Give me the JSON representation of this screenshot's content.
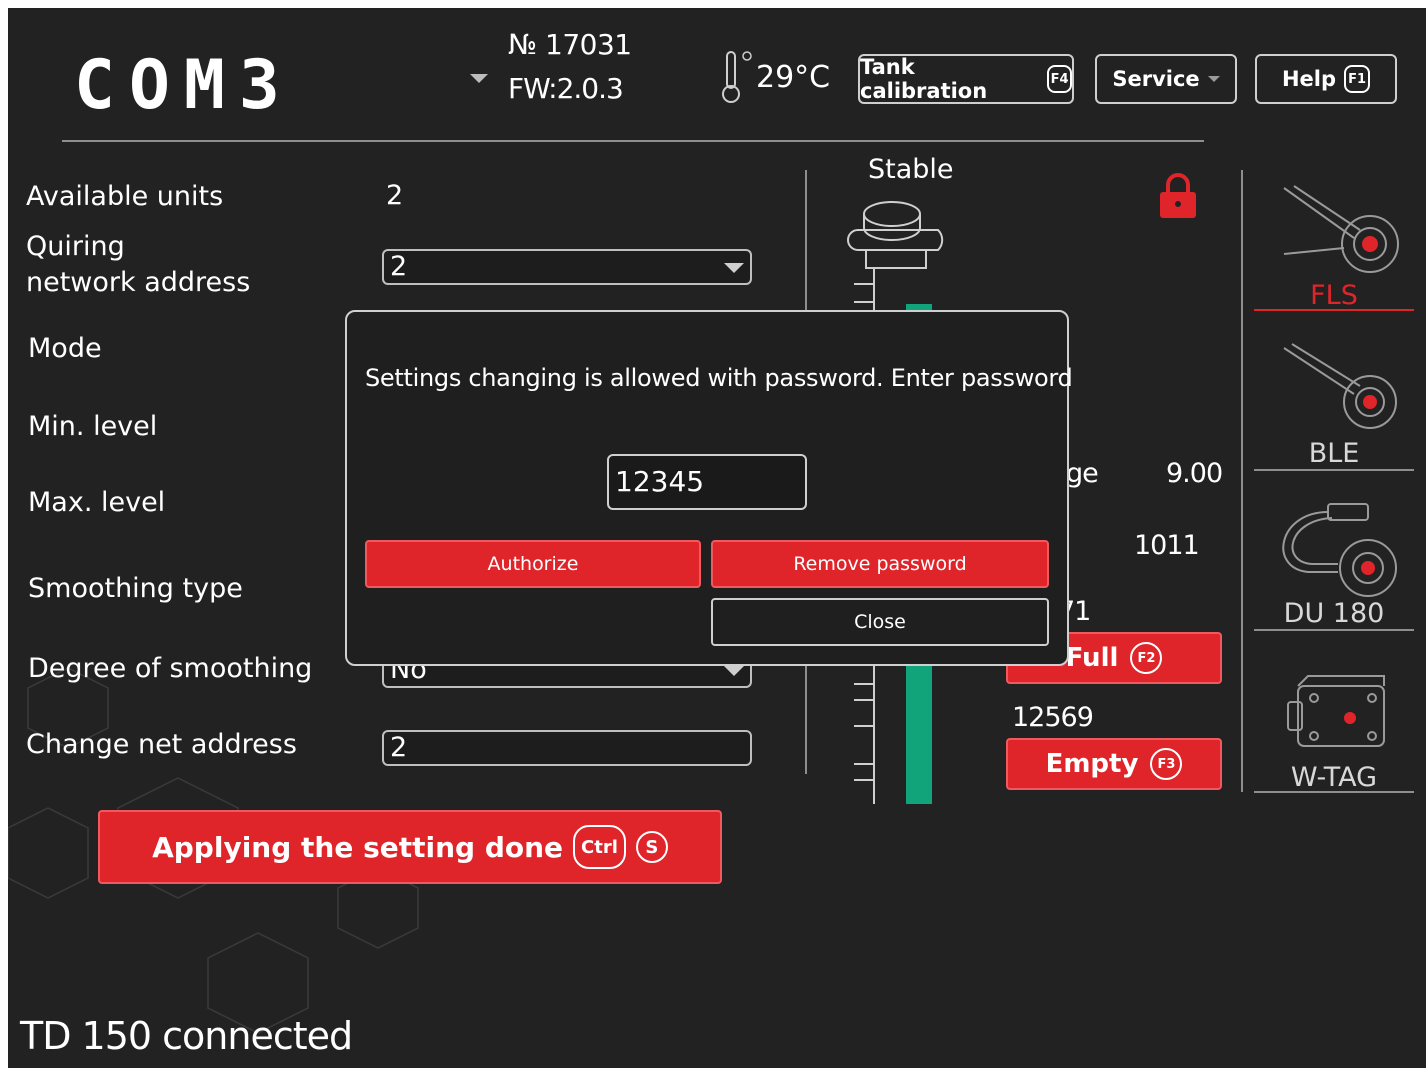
{
  "header": {
    "logo": "COM3",
    "serial": "№ 17031",
    "firmware": "FW:2.0.3",
    "temperature": "29°C",
    "buttons": {
      "tank_calibration": "Tank calibration",
      "tank_calibration_key": "F4",
      "service": "Service",
      "help": "Help",
      "help_key": "F1"
    }
  },
  "form": {
    "available_units_label": "Available units",
    "available_units_value": "2",
    "quiring_label_line1": "Quiring",
    "quiring_label_line2": "network address",
    "quiring_value": "2",
    "mode_label": "Mode",
    "min_level_label": "Min. level",
    "max_level_label": "Max. level",
    "smoothing_type_label": "Smoothing type",
    "degree_of_smoothing_label": "Degree of smoothing",
    "degree_of_smoothing_value": "No",
    "change_net_address_label": "Change net address",
    "change_net_address_value": "2",
    "apply_button": "Applying the setting done",
    "apply_key1": "Ctrl",
    "apply_key2": "S"
  },
  "status": "TD 150 connected",
  "sensor": {
    "state": "Stable",
    "partial_label": "ge",
    "partial_value": "9.00",
    "value_2": "1011",
    "value_3_partial": "71",
    "full_button": "Full",
    "full_key": "F2",
    "empty_value": "12569",
    "empty_button": "Empty",
    "empty_key": "F3"
  },
  "sidebar": {
    "items": [
      {
        "label": "FLS",
        "active": true
      },
      {
        "label": "BLE",
        "active": false
      },
      {
        "label": "DU 180",
        "active": false
      },
      {
        "label": "W-TAG",
        "active": false
      }
    ]
  },
  "dialog": {
    "message": "Settings changing is allowed with password. Enter password",
    "password_value": "12345",
    "authorize_button": "Authorize",
    "remove_password_button": "Remove password",
    "close_button": "Close"
  },
  "colors": {
    "accent": "#e0252a",
    "background": "#222223",
    "level_bar": "#11a37a"
  }
}
